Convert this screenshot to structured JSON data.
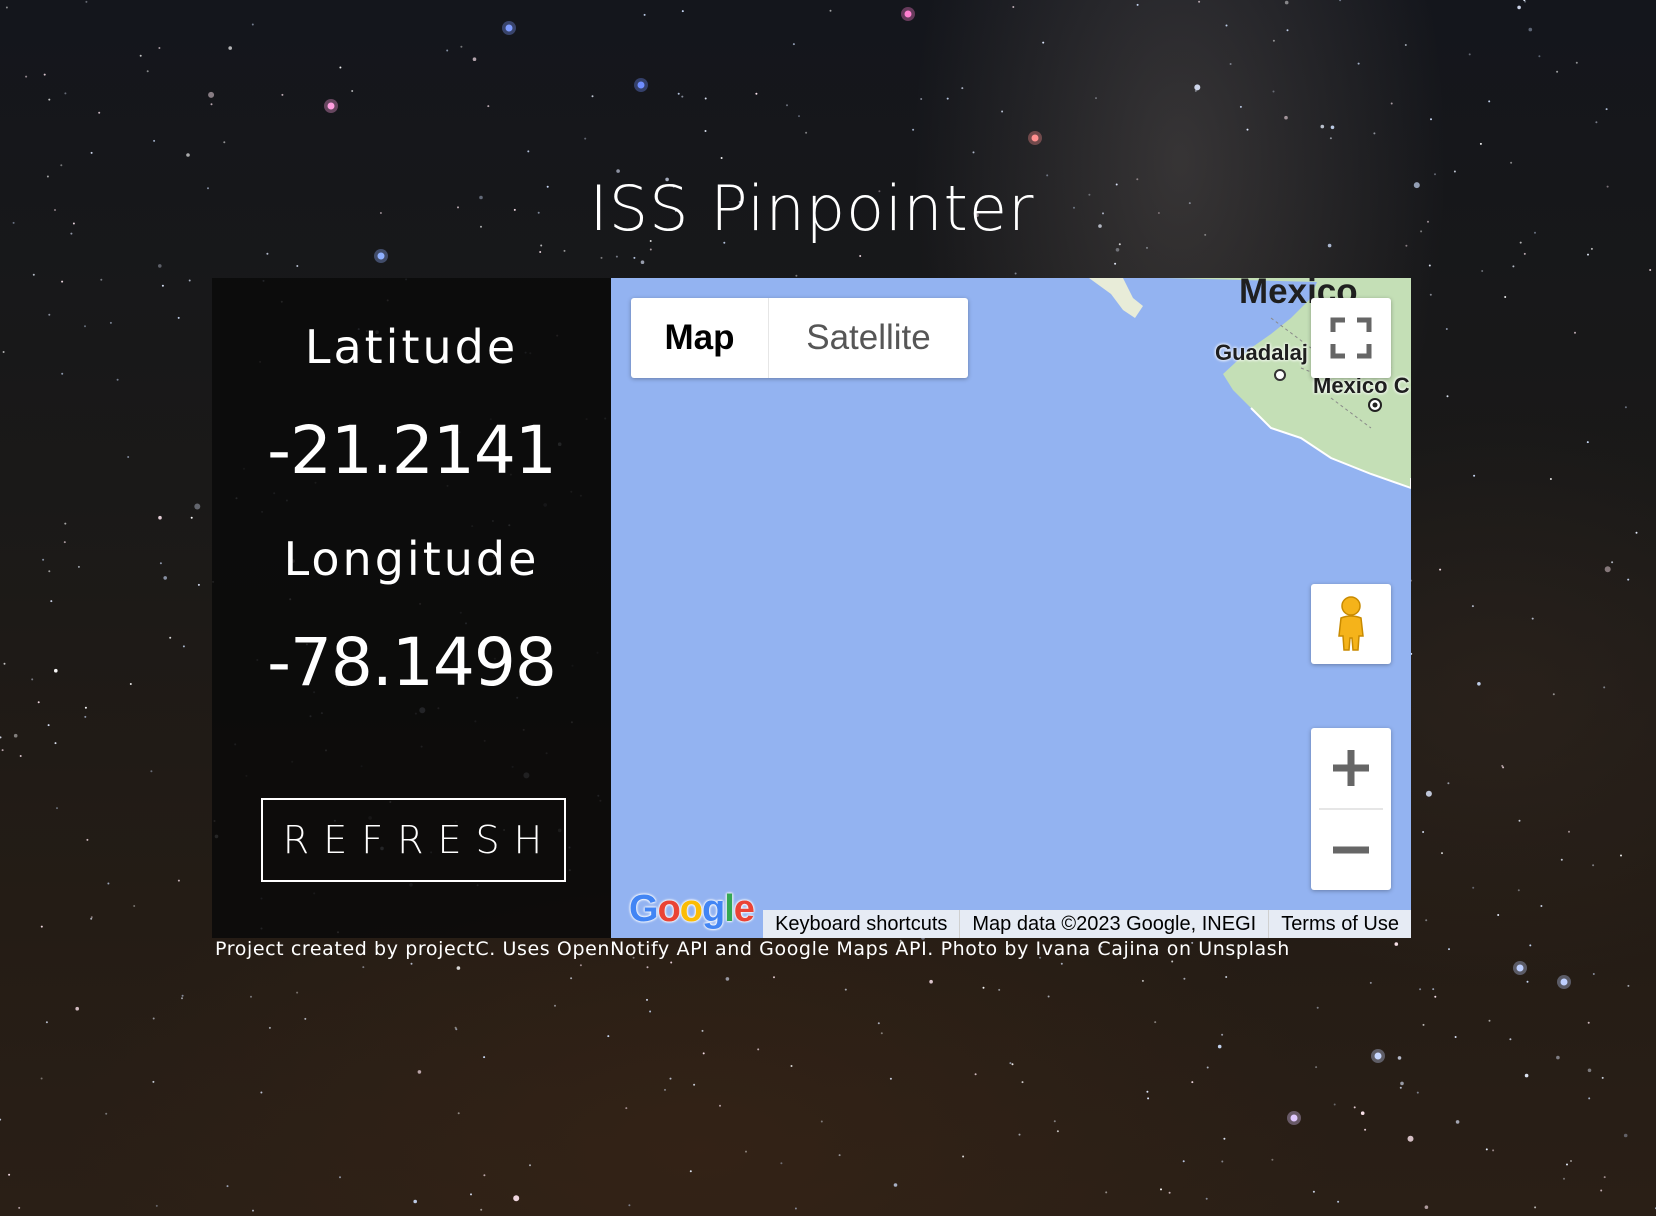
{
  "app": {
    "title": "ISS Pinpointer"
  },
  "position": {
    "latitude_label": "Latitude",
    "latitude_value": "-21.2141",
    "longitude_label": "Longitude",
    "longitude_value": "-78.1498",
    "refresh_label": "REFRESH"
  },
  "map": {
    "type_controls": {
      "map_label": "Map",
      "satellite_label": "Satellite",
      "selected": "Map"
    },
    "labels": {
      "country": "Mexico",
      "city1": "Guadalaj",
      "city2": "Mexico C"
    },
    "logo": "Google",
    "attribution": {
      "shortcuts": "Keyboard shortcuts",
      "data": "Map data ©2023 Google, INEGI",
      "terms": "Terms of Use"
    },
    "icons": {
      "fullscreen": "fullscreen-icon",
      "pegman": "pegman-icon",
      "zoom_in": "plus-icon",
      "zoom_out": "minus-icon"
    },
    "colors": {
      "water": "#93b3f1",
      "land": "#c4dfb6"
    }
  },
  "footer": {
    "text": "Project created by projectC. Uses OpenNotify API and Google Maps API. Photo by Ivana Cajina on Unsplash"
  }
}
